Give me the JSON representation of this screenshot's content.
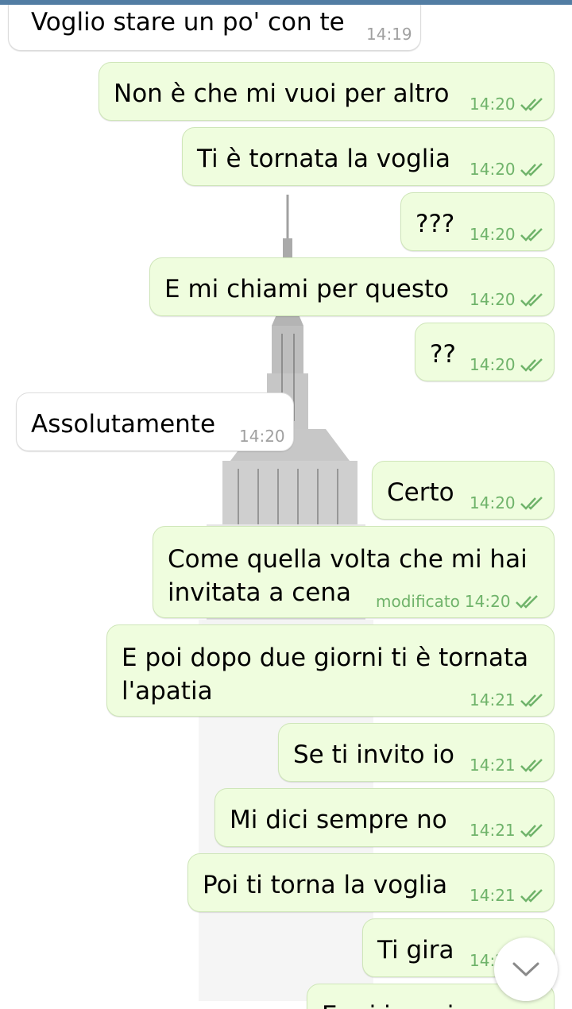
{
  "messages": [
    {
      "dir": "in",
      "text": "Voglio stare un po' con te",
      "time": "14:19"
    },
    {
      "dir": "out",
      "text": "Non è che mi vuoi per altro",
      "time": "14:20",
      "status": "read"
    },
    {
      "dir": "out",
      "text": "Ti è tornata la voglia",
      "time": "14:20",
      "status": "read"
    },
    {
      "dir": "out",
      "text": "???",
      "time": "14:20",
      "status": "read"
    },
    {
      "dir": "out",
      "text": "E mi chiami per questo",
      "time": "14:20",
      "status": "read"
    },
    {
      "dir": "out",
      "text": "??",
      "time": "14:20",
      "status": "read"
    },
    {
      "dir": "in",
      "text": "Assolutamente",
      "time": "14:20"
    },
    {
      "dir": "out",
      "text": "Certo",
      "time": "14:20",
      "status": "read"
    },
    {
      "dir": "out",
      "text": "Come quella volta che mi hai\ninvitata a cena",
      "edited": "modificato",
      "time": "14:20",
      "status": "read"
    },
    {
      "dir": "out",
      "text": "E poi dopo due giorni ti è tornata\nl'apatia",
      "time": "14:21",
      "status": "read"
    },
    {
      "dir": "out",
      "text": "Se ti invito io",
      "time": "14:21",
      "status": "read"
    },
    {
      "dir": "out",
      "text": "Mi dici sempre no",
      "time": "14:21",
      "status": "read"
    },
    {
      "dir": "out",
      "text": "Poi ti torna la voglia",
      "time": "14:21",
      "status": "read"
    },
    {
      "dir": "out",
      "text": "Ti gira",
      "time": "14:21",
      "status": "read"
    },
    {
      "dir": "out",
      "text": "E mi ignori",
      "time": "",
      "status": ""
    }
  ],
  "scroll_button": {
    "icon": "chevron-down-icon"
  },
  "colors": {
    "topbar": "#527da3",
    "outgoing_bubble": "#effdde",
    "incoming_bubble": "#ffffff",
    "outgoing_meta": "#6fb36a",
    "incoming_meta": "#a0a0a0"
  }
}
